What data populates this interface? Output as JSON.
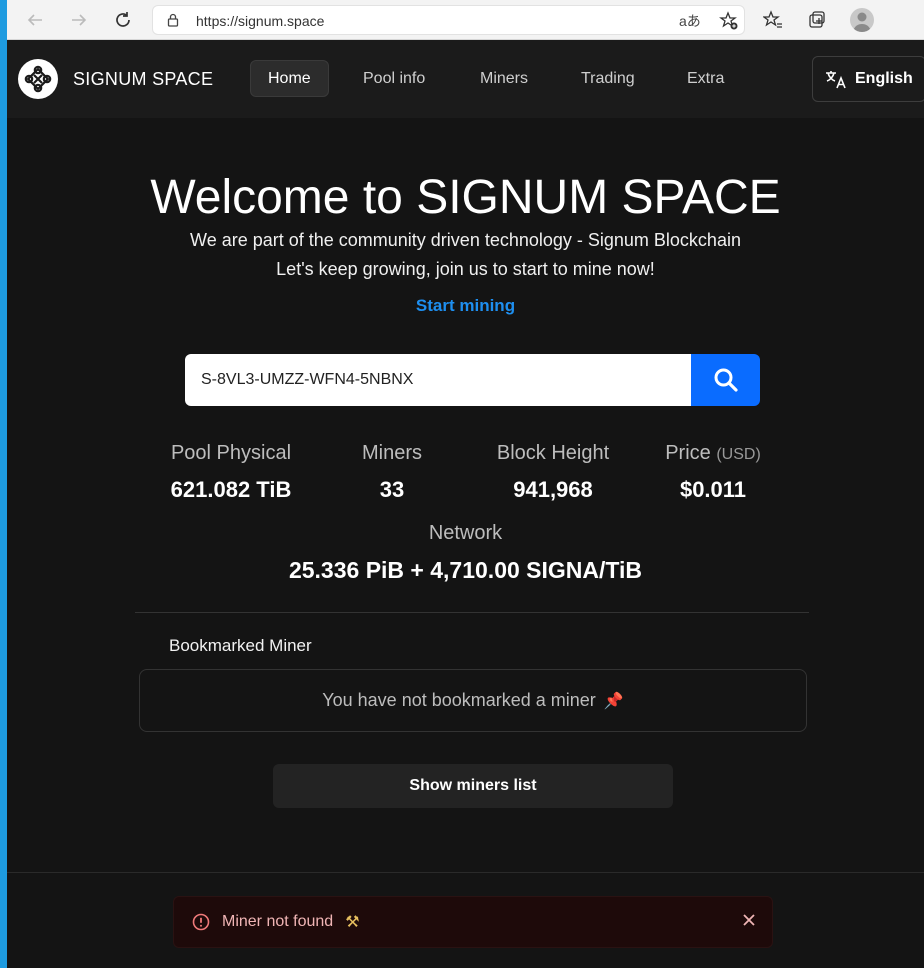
{
  "browser": {
    "url": "https://signum.space",
    "read_aloud": "aあ"
  },
  "header": {
    "brand": "SIGNUM SPACE",
    "nav": [
      {
        "label": "Home",
        "active": true
      },
      {
        "label": "Pool info"
      },
      {
        "label": "Miners"
      },
      {
        "label": "Trading"
      },
      {
        "label": "Extra"
      }
    ],
    "language": "English"
  },
  "hero": {
    "title": "Welcome to SIGNUM SPACE",
    "subtitle1": "We are part of the community driven technology - Signum Blockchain",
    "subtitle2": "Let's keep growing, join us to start to mine now!",
    "start_link": "Start mining"
  },
  "search": {
    "value": "S-8VL3-UMZZ-WFN4-5NBNX"
  },
  "stats": {
    "pool_physical": {
      "label": "Pool Physical",
      "value": "621.082 TiB"
    },
    "miners": {
      "label": "Miners",
      "value": "33"
    },
    "block_height": {
      "label": "Block Height",
      "value": "941,968"
    },
    "price": {
      "label": "Price",
      "unit": "(USD)",
      "value": "$0.011"
    },
    "network": {
      "label": "Network",
      "value": "25.336 PiB + 4,710.00 SIGNA/TiB"
    }
  },
  "bookmark": {
    "title": "Bookmarked Miner",
    "empty_text": "You have not bookmarked a miner",
    "pin_emoji": "📌"
  },
  "show_miners_label": "Show miners list",
  "toast": {
    "message": "Miner not found",
    "emoji": "⚒"
  },
  "colors": {
    "accent": "#0a6cff",
    "link": "#1e8ff0",
    "background": "#141414"
  }
}
